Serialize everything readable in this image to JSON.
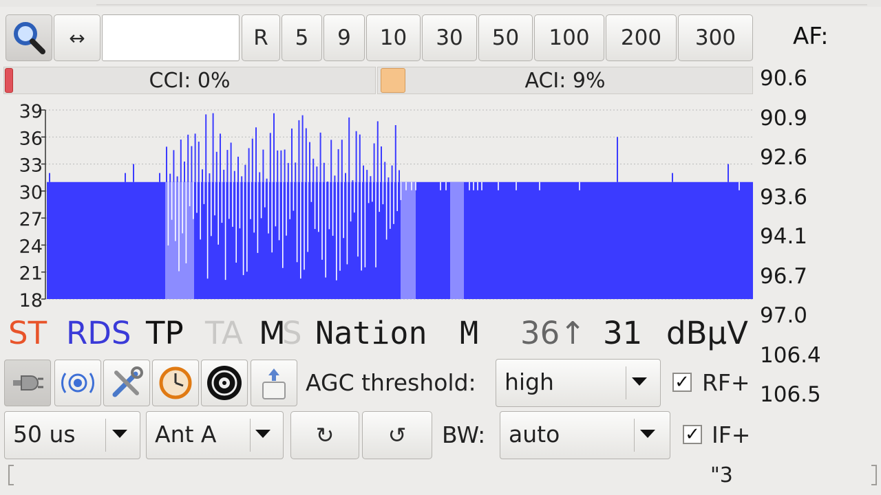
{
  "toolbar": {
    "search_icon": "magnifier-icon",
    "arrows_label": "↔",
    "frequency_value": "",
    "presets": [
      "R",
      "5",
      "9",
      "10",
      "30",
      "50",
      "100",
      "200",
      "300"
    ]
  },
  "af": {
    "label": "AF:",
    "items": [
      "90.6",
      "90.9",
      "92.6",
      "93.6",
      "94.1",
      "96.7",
      "97.0",
      "106.4",
      "106.5"
    ]
  },
  "interference": {
    "cci_label": "CCI: 0%",
    "cci_percent": 0,
    "aci_label": "ACI: 9%",
    "aci_percent": 9,
    "cci_color": "#e0525a",
    "aci_color": "#f6c389"
  },
  "chart_data": {
    "type": "bar",
    "y_ticks": [
      "39",
      "36",
      "33",
      "30",
      "27",
      "24",
      "21",
      "18"
    ],
    "ylim": [
      18,
      39
    ],
    "grid": true,
    "baseline_level": 31,
    "bar_color": "#3b3bff",
    "highlight_color": "#8c8cff"
  },
  "status": {
    "st": "ST",
    "rds": "RDS",
    "tp": "TP",
    "ta": "TA",
    "m": "M",
    "s": "S",
    "ps": "Nation",
    "pty": "M",
    "peak": "36↑",
    "level": "31",
    "unit": "dBµV",
    "colors": {
      "st": "#e8542a",
      "rds": "#3a3ad8",
      "tp": "#111111",
      "ta_dim": "#c9c8c6",
      "s_dim": "#c9c8c6",
      "peak": "#666666"
    }
  },
  "controls": {
    "icons": [
      "plug-icon",
      "antenna-signal-icon",
      "tools-icon",
      "clock-icon",
      "vinyl-record-icon",
      "upload-lock-icon"
    ],
    "agc_label": "AGC threshold:",
    "agc_value": "high",
    "rf_label": "RF+",
    "rf_checked": true,
    "deemphasis_value": "50 us",
    "antenna_value": "Ant A",
    "rotate_cw": "↻",
    "rotate_ccw": "↺",
    "bw_label": "BW:",
    "bw_value": "auto",
    "if_label": "IF+",
    "if_checked": true,
    "bottom_text": "\"3"
  }
}
